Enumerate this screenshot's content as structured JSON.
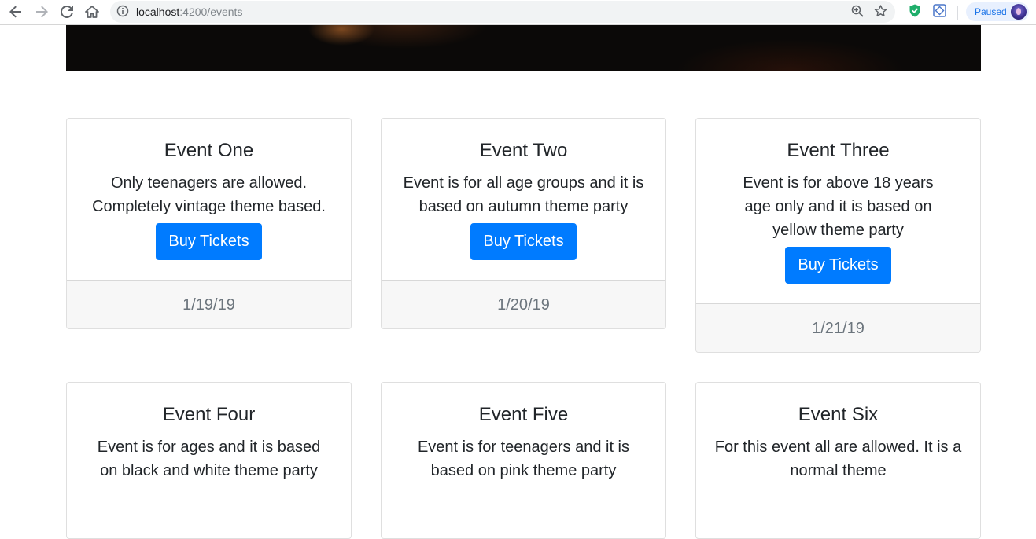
{
  "browser": {
    "url_host": "localhost",
    "url_path": ":4200/events",
    "profile_label": "Paused"
  },
  "events": [
    {
      "title": "Event One",
      "desc": "Only teenagers are allowed. Completely vintage theme based.",
      "button": "Buy Tickets",
      "date": "1/19/19"
    },
    {
      "title": "Event Two",
      "desc": "Event is for all age groups and it is based on autumn theme party",
      "button": "Buy Tickets",
      "date": "1/20/19"
    },
    {
      "title": "Event Three",
      "desc": "Event is for above 18 years age only and it is based on yellow theme party",
      "button": "Buy Tickets",
      "date": "1/21/19"
    },
    {
      "title": "Event Four",
      "desc": "Event is for ages and it is based on black and white theme party"
    },
    {
      "title": "Event Five",
      "desc": "Event is for teenagers and it is based on pink theme party"
    },
    {
      "title": "Event Six",
      "desc": "For this event all are allowed. It is a normal theme"
    }
  ],
  "colors": {
    "primary_button": "#007bff",
    "footer_bg": "#f7f7f7",
    "date_text": "#6c757d"
  }
}
